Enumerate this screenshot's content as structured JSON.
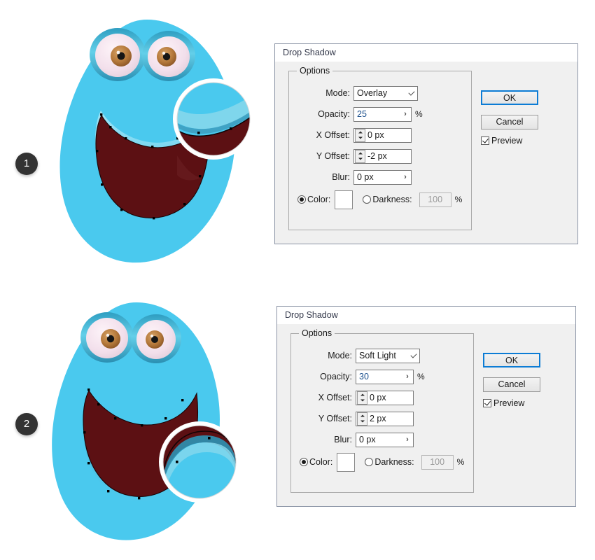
{
  "steps": [
    {
      "number": "1"
    },
    {
      "number": "2"
    }
  ],
  "dialogs": [
    {
      "title": "Drop Shadow",
      "options_legend": "Options",
      "mode_label": "Mode:",
      "mode_value": "Overlay",
      "opacity_label": "Opacity:",
      "opacity_value": "25",
      "opacity_unit": "%",
      "xoffset_label": "X Offset:",
      "xoffset_value": "0 px",
      "yoffset_label": "Y Offset:",
      "yoffset_value": "-2 px",
      "blur_label": "Blur:",
      "blur_value": "0 px",
      "color_label": "Color:",
      "color_swatch": "#ffffff",
      "darkness_label": "Darkness:",
      "darkness_value": "100",
      "darkness_unit": "%",
      "ok_label": "OK",
      "cancel_label": "Cancel",
      "preview_label": "Preview",
      "arrow_glyph": "›"
    },
    {
      "title": "Drop Shadow",
      "options_legend": "Options",
      "mode_label": "Mode:",
      "mode_value": "Soft Light",
      "opacity_label": "Opacity:",
      "opacity_value": "30",
      "opacity_unit": "%",
      "xoffset_label": "X Offset:",
      "xoffset_value": "0 px",
      "yoffset_label": "Y Offset:",
      "yoffset_value": "2 px",
      "blur_label": "Blur:",
      "blur_value": "0 px",
      "color_label": "Color:",
      "color_swatch": "#ffffff",
      "darkness_label": "Darkness:",
      "darkness_value": "100",
      "darkness_unit": "%",
      "ok_label": "OK",
      "cancel_label": "Cancel",
      "preview_label": "Preview",
      "arrow_glyph": "›"
    }
  ],
  "artwork": {
    "body_color": "#4ac9ee",
    "mouth_color": "#5c1013",
    "eye_rim_color": "#37a6c9",
    "eye_white_color": "#f5e6ef",
    "iris_color": "#b5793b",
    "pupil_color": "#151515",
    "magnifier_ring_color": "#ffffff",
    "shadow_light_color": "#8fdcf0",
    "shadow_dark_color": "#2e93b5"
  }
}
